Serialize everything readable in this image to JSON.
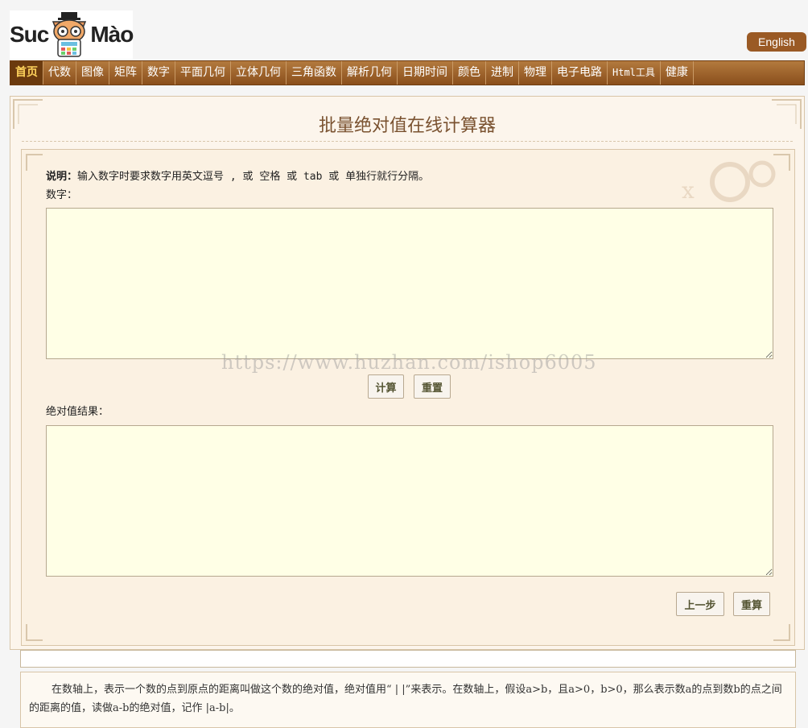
{
  "header": {
    "logo_left": "Suc",
    "logo_right": "Mào",
    "lang_label": "English"
  },
  "nav": {
    "items": [
      "首页",
      "代数",
      "图像",
      "矩阵",
      "数字",
      "平面几何",
      "立体几何",
      "三角函数",
      "解析几何",
      "日期时间",
      "颜色",
      "进制",
      "物理",
      "电子电路",
      "Html工具",
      "健康"
    ]
  },
  "page": {
    "title": "批量绝对值在线计算器",
    "desc_label": "说明：",
    "desc_text": "输入数字时要求数字用英文逗号 , 或 空格 或 tab 或 单独行就行分隔。",
    "input_label": "数字：",
    "calc_button": "计算",
    "reset_button": "重置",
    "result_label": "绝对值结果：",
    "prev_button": "上一步",
    "recalc_button": "重算",
    "watermark": "https://www.huzhan.com/ishop6005",
    "info_text": "在数轴上，表示一个数的点到原点的距离叫做这个数的绝对值，绝对值用“ | |”来表示。在数轴上，假设a>b，且a>0，b>0，那么表示数a的点到数b的点之间的距离的值，读做a-b的绝对值，记作 |a-b|。"
  },
  "colors": {
    "nav": "#9a5a25",
    "active_nav_text": "#ffd35c",
    "textarea_bg": "#ffffe6"
  }
}
